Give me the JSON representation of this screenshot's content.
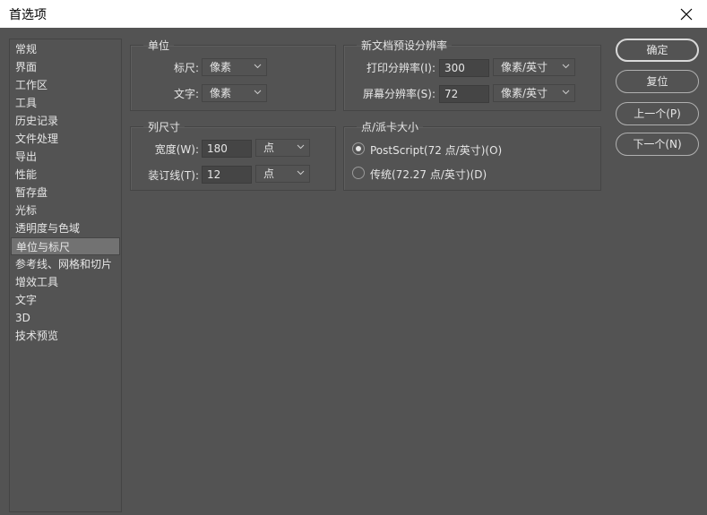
{
  "window": {
    "title": "首选项"
  },
  "sidebar": {
    "items": [
      {
        "label": "常规"
      },
      {
        "label": "界面"
      },
      {
        "label": "工作区"
      },
      {
        "label": "工具"
      },
      {
        "label": "历史记录"
      },
      {
        "label": "文件处理"
      },
      {
        "label": "导出"
      },
      {
        "label": "性能"
      },
      {
        "label": "暂存盘"
      },
      {
        "label": "光标"
      },
      {
        "label": "透明度与色域"
      },
      {
        "label": "单位与标尺"
      },
      {
        "label": "参考线、网格和切片"
      },
      {
        "label": "增效工具"
      },
      {
        "label": "文字"
      },
      {
        "label": "3D"
      },
      {
        "label": "技术预览"
      }
    ],
    "selected": "单位与标尺"
  },
  "units": {
    "legend": "单位",
    "ruler_label": "标尺:",
    "ruler_value": "像素",
    "type_label": "文字:",
    "type_value": "像素"
  },
  "resolution": {
    "legend": "新文档预设分辨率",
    "print_label": "打印分辨率(I):",
    "print_value": "300",
    "print_unit": "像素/英寸",
    "screen_label": "屏幕分辨率(S):",
    "screen_value": "72",
    "screen_unit": "像素/英寸"
  },
  "column": {
    "legend": "列尺寸",
    "width_label": "宽度(W):",
    "width_value": "180",
    "width_unit": "点",
    "gutter_label": "装订线(T):",
    "gutter_value": "12",
    "gutter_unit": "点"
  },
  "pica": {
    "legend": "点/派卡大小",
    "option1": "PostScript(72 点/英寸)(O)",
    "option2": "传统(72.27 点/英寸)(D)",
    "selected": "option1"
  },
  "buttons": {
    "ok": "确定",
    "reset": "复位",
    "prev": "上一个(P)",
    "next": "下一个(N)"
  }
}
